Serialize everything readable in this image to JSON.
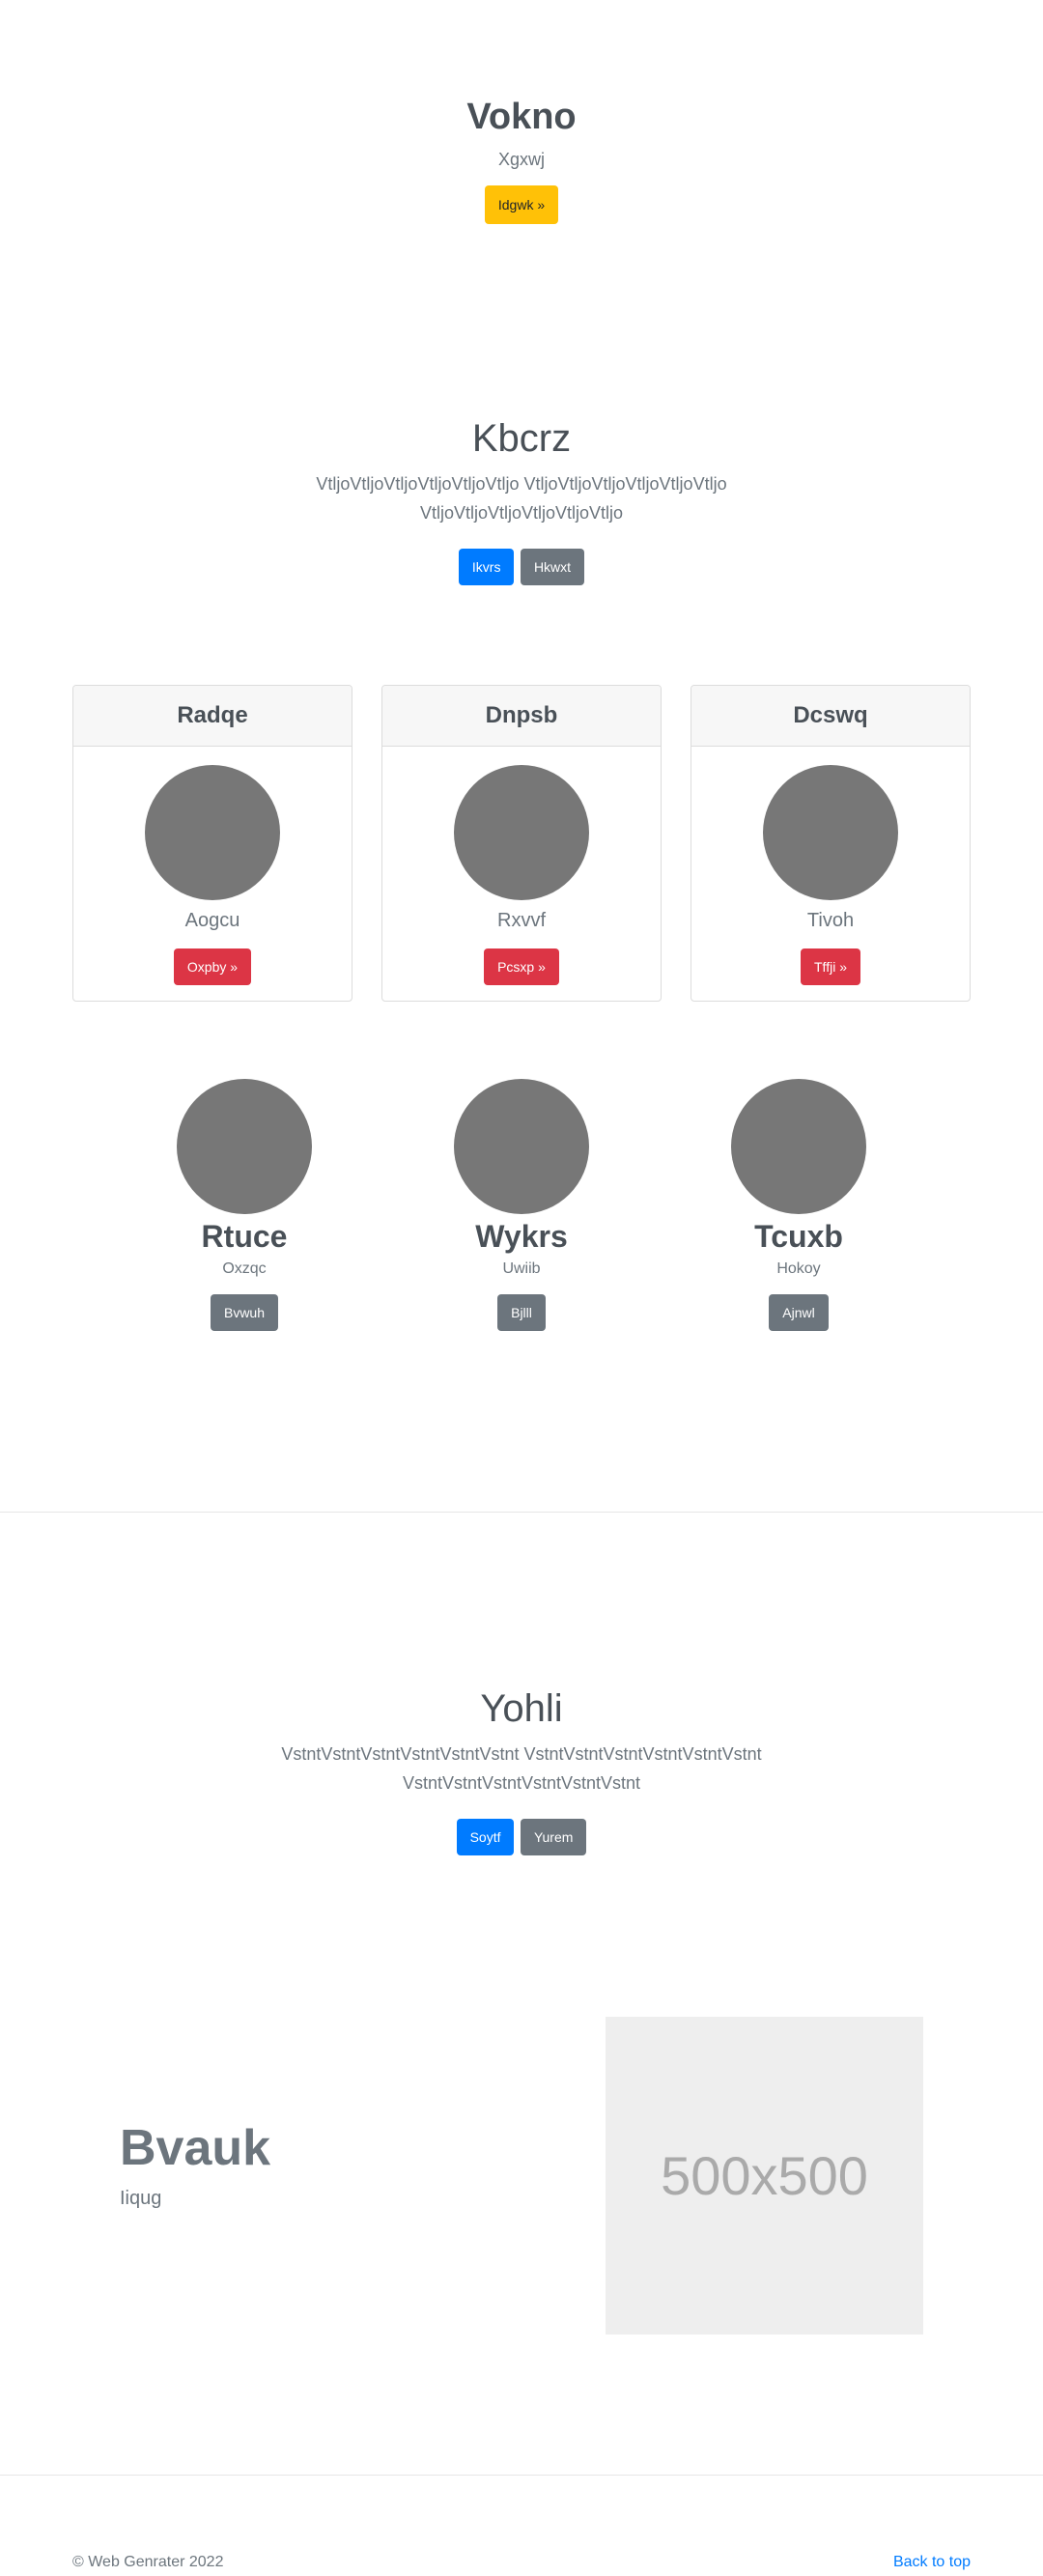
{
  "hero": {
    "title": "Vokno",
    "subtitle": "Xgxwj",
    "button": "Idgwk »"
  },
  "section1": {
    "title": "Kbcrz",
    "text": "VtljoVtljoVtljoVtljoVtljoVtljo VtljoVtljoVtljoVtljoVtljoVtljo VtljoVtljoVtljoVtljoVtljoVtljo",
    "primary_button": "Ikvrs",
    "secondary_button": "Hkwxt"
  },
  "cards": [
    {
      "header": "Radqe",
      "caption": "Aogcu",
      "button": "Oxpby »"
    },
    {
      "header": "Dnpsb",
      "caption": "Rxvvf",
      "button": "Pcsxp »"
    },
    {
      "header": "Dcswq",
      "caption": "Tivoh",
      "button": "Tffji »"
    }
  ],
  "team": [
    {
      "name": "Rtuce",
      "subtitle": "Oxzqc",
      "button": "Bvwuh"
    },
    {
      "name": "Wykrs",
      "subtitle": "Uwiib",
      "button": "Bjlll"
    },
    {
      "name": "Tcuxb",
      "subtitle": "Hokoy",
      "button": "Ajnwl"
    }
  ],
  "section2": {
    "title": "Yohli",
    "text": "VstntVstntVstntVstntVstntVstnt VstntVstntVstntVstntVstntVstnt VstntVstntVstntVstntVstntVstnt",
    "primary_button": "Soytf",
    "secondary_button": "Yurem"
  },
  "feature": {
    "title": "Bvauk",
    "subtitle": "Iiqug",
    "image_label": "500x500"
  },
  "footer": {
    "copyright": "© Web Genrater 2022",
    "back_to_top": "Back to top"
  },
  "colors": {
    "primary": "#007bff",
    "secondary": "#6c757d",
    "danger": "#dc3545",
    "warning": "#ffc107"
  }
}
